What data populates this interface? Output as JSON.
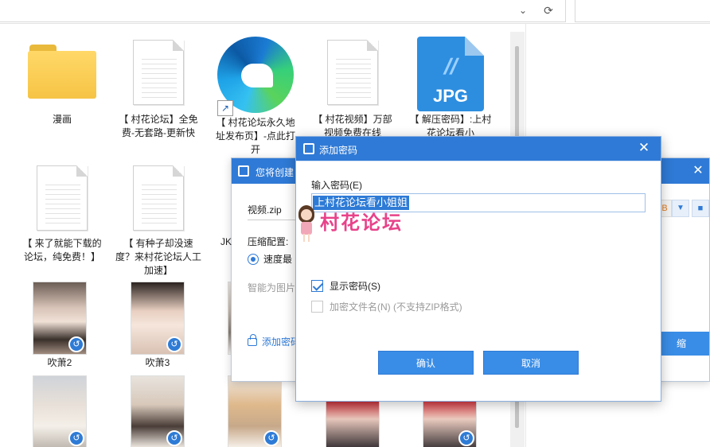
{
  "address_bar": {
    "dropdown_icon": "chevron-down-icon",
    "refresh_icon": "refresh-icon"
  },
  "files": [
    {
      "type": "folder",
      "name": "漫画"
    },
    {
      "type": "document",
      "name": "【 村花论坛】全免费-无套路-更新快"
    },
    {
      "type": "edge-shortcut",
      "name": "【 村花论坛永久地址发布页】-点此打开"
    },
    {
      "type": "document",
      "name": "【 村花视频】万部视频免费在线"
    },
    {
      "type": "jpg",
      "name": "【 解压密码】:上村花论坛看小",
      "ext": "JPG"
    },
    {
      "type": "document",
      "name": "【 来了就能下载的论坛，纯免费！】"
    },
    {
      "type": "document",
      "name": "【 有种子却没速度？来村花论坛人工加速】"
    },
    {
      "type": "video",
      "name": "吹萧2"
    },
    {
      "type": "video",
      "name": "吹萧3"
    },
    {
      "type": "video",
      "name": ""
    },
    {
      "type": "video",
      "name": ""
    },
    {
      "type": "video",
      "name": ""
    },
    {
      "type": "video",
      "name": ""
    },
    {
      "type": "video",
      "name": ""
    }
  ],
  "compress_dialog": {
    "title": "您将创建",
    "filename": "视频.zip",
    "config_label": "压缩配置:",
    "speed_option": "速度最",
    "smart_text": "智能为图片",
    "add_password_link": "添加密码",
    "format_badge": "B",
    "compress_button": "缩",
    "partial_label": "JK"
  },
  "password_dialog": {
    "title": "添加密码",
    "input_label": "输入密码(E)",
    "password_value": "上村花论坛看小姐姐",
    "show_password_label": "显示密码(S)",
    "show_password_checked": true,
    "encrypt_filename_label": "加密文件名(N) (不支持ZIP格式)",
    "encrypt_filename_checked": false,
    "confirm_button": "确认",
    "cancel_button": "取消"
  },
  "watermark": {
    "text": "村花论坛"
  },
  "colors": {
    "accent": "#2f7ad6",
    "button": "#3a8de6",
    "watermark": "#e8428a"
  }
}
